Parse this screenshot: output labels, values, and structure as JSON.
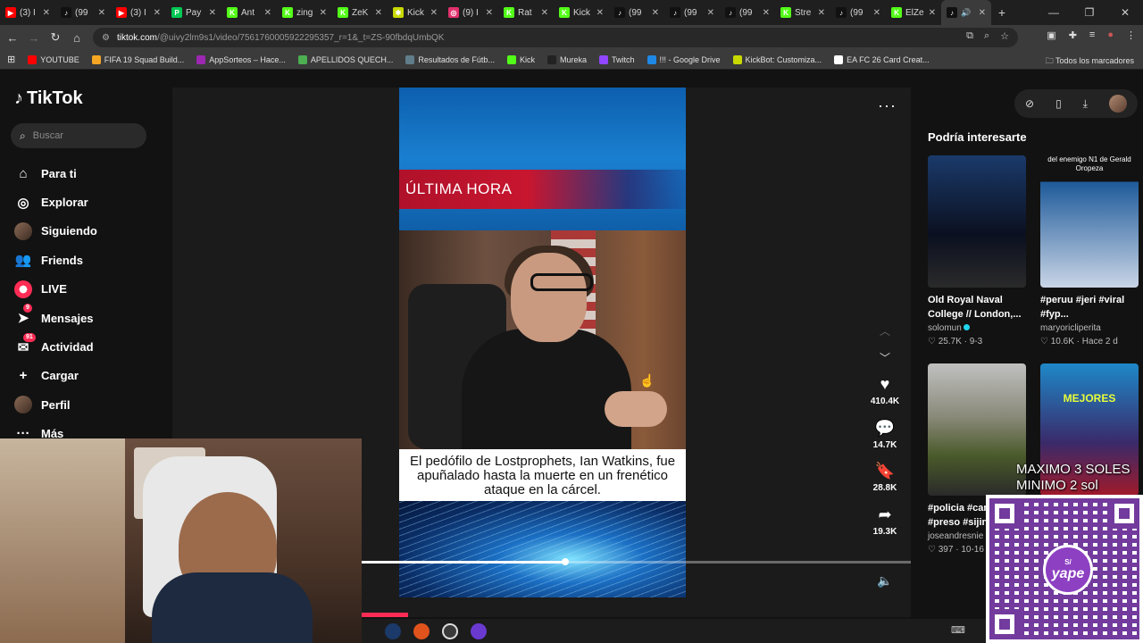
{
  "browser": {
    "tabs": [
      {
        "label": "(3) I",
        "color": "#ff0000",
        "glyph": "▶"
      },
      {
        "label": "(99",
        "color": "#111111",
        "glyph": "♪"
      },
      {
        "label": "(3) I",
        "color": "#ff0000",
        "glyph": "▶"
      },
      {
        "label": "Pay",
        "color": "#00c853",
        "glyph": "P"
      },
      {
        "label": "Ant",
        "color": "#53fc18",
        "glyph": "K"
      },
      {
        "label": "zing",
        "color": "#53fc18",
        "glyph": "K"
      },
      {
        "label": "ZeK",
        "color": "#53fc18",
        "glyph": "K"
      },
      {
        "label": "Kick",
        "color": "#c7d900",
        "glyph": "✱"
      },
      {
        "label": "(9) I",
        "color": "#e1306c",
        "glyph": "◎"
      },
      {
        "label": "Rat",
        "color": "#53fc18",
        "glyph": "K"
      },
      {
        "label": "Kick",
        "color": "#53fc18",
        "glyph": "K"
      },
      {
        "label": "(99",
        "color": "#111111",
        "glyph": "♪"
      },
      {
        "label": "(99",
        "color": "#111111",
        "glyph": "♪"
      },
      {
        "label": "(99",
        "color": "#111111",
        "glyph": "♪"
      },
      {
        "label": "Stre",
        "color": "#53fc18",
        "glyph": "K"
      },
      {
        "label": "(99",
        "color": "#111111",
        "glyph": "♪"
      },
      {
        "label": "ElZe",
        "color": "#53fc18",
        "glyph": "K"
      }
    ],
    "url_host": "tiktok.com",
    "url_path": "/@uivy2lm9s1/video/7561760005922295357_r=1&_t=ZS-90fbdqUmbQK",
    "bookmarks": [
      {
        "label": "YOUTUBE",
        "color": "#ff0000"
      },
      {
        "label": "FIFA 19 Squad Build...",
        "color": "#f5a623"
      },
      {
        "label": "AppSorteos – Hace...",
        "color": "#9c27b0"
      },
      {
        "label": "APELLIDOS QUECH...",
        "color": "#4caf50"
      },
      {
        "label": "Resultados de Fútb...",
        "color": "#607d8b"
      },
      {
        "label": "Kick",
        "color": "#53fc18"
      },
      {
        "label": "Mureka",
        "color": "#222222"
      },
      {
        "label": "Twitch",
        "color": "#9146ff"
      },
      {
        "label": "!!! - Google Drive",
        "color": "#1e88e5"
      },
      {
        "label": "KickBot: Customiza...",
        "color": "#c7d900"
      },
      {
        "label": "EA FC 26 Card Creat...",
        "color": "#ffffff"
      }
    ],
    "bookmarks_all": "Todos los marcadores"
  },
  "sidebar": {
    "logo": "TikTok",
    "search_placeholder": "Buscar",
    "items": [
      {
        "label": "Para ti",
        "icon": "⌂",
        "name": "home"
      },
      {
        "label": "Explorar",
        "icon": "◎",
        "name": "explore"
      },
      {
        "label": "Siguiendo",
        "icon": "avatar",
        "name": "following"
      },
      {
        "label": "Friends",
        "icon": "👥",
        "name": "friends"
      },
      {
        "label": "LIVE",
        "icon": "live",
        "name": "live"
      },
      {
        "label": "Mensajes",
        "icon": "➤",
        "name": "messages",
        "badge": "9"
      },
      {
        "label": "Actividad",
        "icon": "✉",
        "name": "activity",
        "badge": "91"
      },
      {
        "label": "Cargar",
        "icon": "+",
        "name": "upload"
      },
      {
        "label": "Perfil",
        "icon": "avatar",
        "name": "profile"
      },
      {
        "label": "Más",
        "icon": "···",
        "name": "more"
      }
    ]
  },
  "video": {
    "banner": "ÚLTIMA HORA",
    "caption": "El pedófilo de Lostprophets, Ian Watkins, fue apuñalado hasta la muerte en un frenético ataque en la cárcel.",
    "progress": 0.37,
    "actions": [
      {
        "name": "like",
        "icon": "♥",
        "count": "410.4K"
      },
      {
        "name": "comment",
        "icon": "💬",
        "count": "14.7K"
      },
      {
        "name": "bookmark",
        "icon": "🔖",
        "count": "28.8K"
      },
      {
        "name": "share",
        "icon": "➦",
        "count": "19.3K"
      }
    ]
  },
  "recommended": {
    "title": "Podría interesarte",
    "cards": [
      {
        "title": "Old Royal Naval College // London,...",
        "author": "solomun",
        "verified": true,
        "likes": "25.7K",
        "date": "9-3",
        "thumb_text": "",
        "thumb_bg": "linear-gradient(180deg,#1a3a6a,#0b1020 60%,#2a2a2a)"
      },
      {
        "title": "#peruu #jeri #viral #fyp...",
        "author": "maryoricliperita",
        "verified": false,
        "likes": "10.6K",
        "date": "Hace 2 d",
        "thumb_text": "del enemigo N1 de Gerald Oropeza",
        "thumb_bg": "linear-gradient(180deg,#121212 0 20%,#1e5a9a 20%,#c9d5e6 100%)"
      },
      {
        "title": "#policia #cam #preso #sijin",
        "author": "joseandresnie",
        "verified": false,
        "likes": "397",
        "date": "10-16",
        "thumb_text": "",
        "thumb_bg": "linear-gradient(180deg,#c0c0c0,#8a8a7a 40%,#4a5a2a 70%,#2a2a2a)"
      },
      {
        "title": "",
        "author": "",
        "verified": false,
        "likes": "",
        "date": "",
        "thumb_text": "MEJORES",
        "thumb_bg": "linear-gradient(180deg,#1e88c8,#3a2a6a 60%,#a01a2a)"
      }
    ]
  },
  "overlay": {
    "donate_line1": "MAXIMO 3 SOLES",
    "donate_line2": "MINIMO 2 sol",
    "yape_label": "yape",
    "yape_currency": "S/"
  }
}
